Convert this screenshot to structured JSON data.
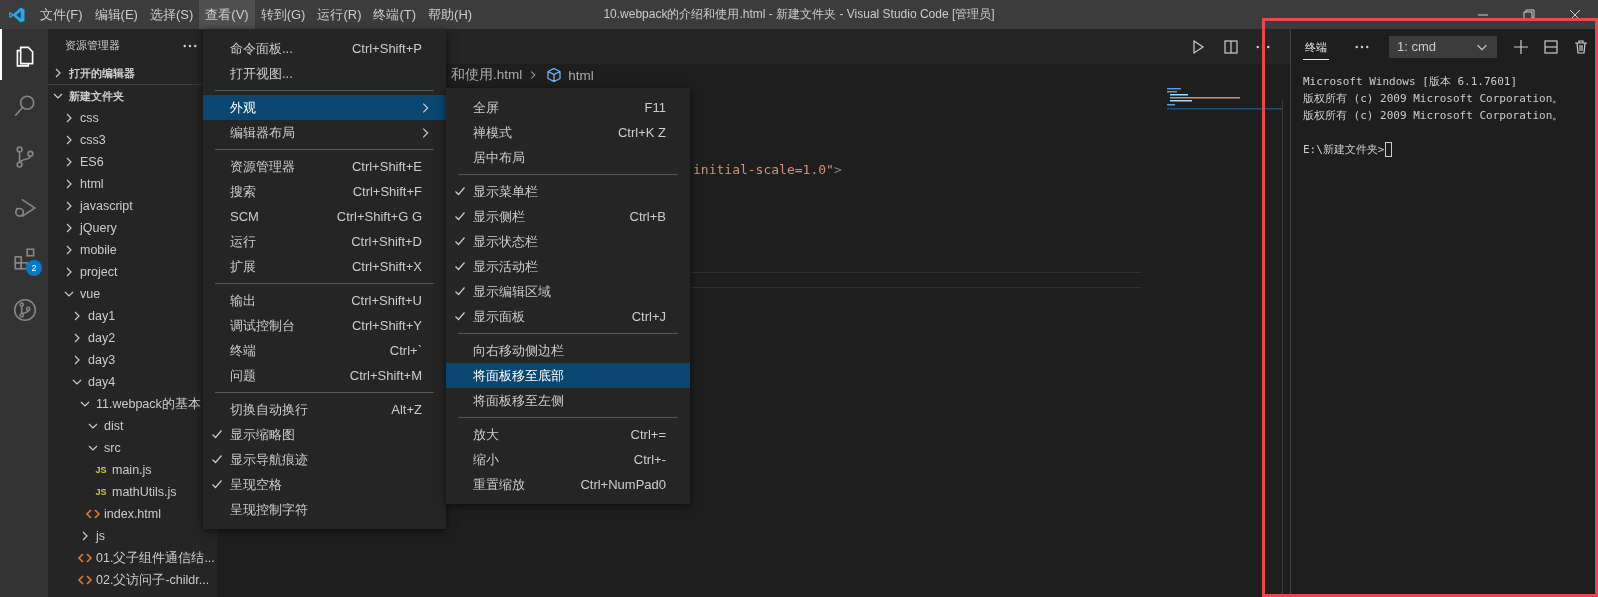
{
  "title_bar": {
    "menus": [
      {
        "label": "文件(F)",
        "selected": false
      },
      {
        "label": "编辑(E)",
        "selected": false
      },
      {
        "label": "选择(S)",
        "selected": false
      },
      {
        "label": "查看(V)",
        "selected": true
      },
      {
        "label": "转到(G)",
        "selected": false
      },
      {
        "label": "运行(R)",
        "selected": false
      },
      {
        "label": "终端(T)",
        "selected": false
      },
      {
        "label": "帮助(H)",
        "selected": false
      }
    ],
    "title": "10.webpack的介绍和使用.html - 新建文件夹 - Visual Studio Code [管理员]"
  },
  "activity_bar": {
    "items": [
      {
        "selected": true
      },
      {
        "selected": false
      },
      {
        "selected": false
      },
      {
        "selected": false
      },
      {
        "selected": false,
        "badge": "2"
      },
      {
        "selected": false
      }
    ]
  },
  "sidebar": {
    "title": "资源管理器",
    "sections": [
      {
        "label": "打开的编辑器",
        "expanded": false
      },
      {
        "label": "新建文件夹",
        "expanded": true,
        "children": [
          {
            "label": "css",
            "kind": "folder",
            "expanded": false
          },
          {
            "label": "css3",
            "kind": "folder",
            "expanded": false
          },
          {
            "label": "ES6",
            "kind": "folder",
            "expanded": false
          },
          {
            "label": "html",
            "kind": "folder",
            "expanded": false
          },
          {
            "label": "javascript",
            "kind": "folder",
            "expanded": false
          },
          {
            "label": "jQuery",
            "kind": "folder",
            "expanded": false
          },
          {
            "label": "mobile",
            "kind": "folder",
            "expanded": false
          },
          {
            "label": "project",
            "kind": "folder",
            "expanded": false
          },
          {
            "label": "vue",
            "kind": "folder",
            "expanded": true,
            "children": [
              {
                "label": "day1",
                "kind": "folder",
                "expanded": false
              },
              {
                "label": "day2",
                "kind": "folder",
                "expanded": false
              },
              {
                "label": "day3",
                "kind": "folder",
                "expanded": false
              },
              {
                "label": "day4",
                "kind": "folder",
                "expanded": true,
                "children": [
                  {
                    "label": "11.webpack的基本",
                    "kind": "folder",
                    "expanded": true,
                    "children": [
                      {
                        "label": "dist",
                        "kind": "folder",
                        "expanded": true
                      },
                      {
                        "label": "src",
                        "kind": "folder",
                        "expanded": true,
                        "children": [
                          {
                            "label": "main.js",
                            "kind": "js",
                            "icon_label": "JS"
                          },
                          {
                            "label": "mathUtils.js",
                            "kind": "js",
                            "icon_label": "JS"
                          }
                        ]
                      },
                      {
                        "label": "index.html",
                        "kind": "html"
                      }
                    ]
                  },
                  {
                    "label": "js",
                    "kind": "folder",
                    "expanded": false
                  },
                  {
                    "label": "01.父子组件通信结...",
                    "kind": "html"
                  },
                  {
                    "label": "02.父访问子-childr...",
                    "kind": "html"
                  }
                ]
              }
            ]
          }
        ]
      }
    ]
  },
  "menu": {
    "items": [
      {
        "kind": "item",
        "label": "命令面板...",
        "shortcut": "Ctrl+Shift+P",
        "checked": false,
        "selected": false
      },
      {
        "kind": "item",
        "label": "打开视图...",
        "checked": false,
        "selected": false
      },
      {
        "kind": "separator"
      },
      {
        "kind": "submenu",
        "label": "外观",
        "checked": false,
        "selected": true
      },
      {
        "kind": "submenu",
        "label": "编辑器布局",
        "checked": false,
        "selected": false
      },
      {
        "kind": "separator"
      },
      {
        "kind": "item",
        "label": "资源管理器",
        "shortcut": "Ctrl+Shift+E",
        "checked": false,
        "selected": false
      },
      {
        "kind": "item",
        "label": "搜索",
        "shortcut": "Ctrl+Shift+F",
        "checked": false,
        "selected": false
      },
      {
        "kind": "item",
        "label": "SCM",
        "shortcut": "Ctrl+Shift+G G",
        "checked": false,
        "selected": false
      },
      {
        "kind": "item",
        "label": "运行",
        "shortcut": "Ctrl+Shift+D",
        "checked": false,
        "selected": false
      },
      {
        "kind": "item",
        "label": "扩展",
        "shortcut": "Ctrl+Shift+X",
        "checked": false,
        "selected": false
      },
      {
        "kind": "separator"
      },
      {
        "kind": "item",
        "label": "输出",
        "shortcut": "Ctrl+Shift+U",
        "checked": false,
        "selected": false
      },
      {
        "kind": "item",
        "label": "调试控制台",
        "shortcut": "Ctrl+Shift+Y",
        "checked": false,
        "selected": false
      },
      {
        "kind": "item",
        "label": "终端",
        "shortcut": "Ctrl+`",
        "checked": false,
        "selected": false
      },
      {
        "kind": "item",
        "label": "问题",
        "shortcut": "Ctrl+Shift+M",
        "checked": false,
        "selected": false
      },
      {
        "kind": "separator"
      },
      {
        "kind": "item",
        "label": "切换自动换行",
        "shortcut": "Alt+Z",
        "checked": false,
        "selected": false
      },
      {
        "kind": "item",
        "label": "显示缩略图",
        "checked": true,
        "selected": false
      },
      {
        "kind": "item",
        "label": "显示导航痕迹",
        "checked": true,
        "selected": false
      },
      {
        "kind": "item",
        "label": "呈现空格",
        "checked": true,
        "selected": false
      },
      {
        "kind": "item",
        "label": "呈现控制字符",
        "checked": false,
        "selected": false
      }
    ]
  },
  "submenu": {
    "items": [
      {
        "kind": "item",
        "label": "全屏",
        "shortcut": "F11",
        "checked": false,
        "selected": false
      },
      {
        "kind": "item",
        "label": "禅模式",
        "shortcut": "Ctrl+K Z",
        "checked": false,
        "selected": false
      },
      {
        "kind": "item",
        "label": "居中布局",
        "checked": false,
        "selected": false
      },
      {
        "kind": "separator"
      },
      {
        "kind": "item",
        "label": "显示菜单栏",
        "checked": true,
        "selected": false
      },
      {
        "kind": "item",
        "label": "显示侧栏",
        "shortcut": "Ctrl+B",
        "checked": true,
        "selected": false
      },
      {
        "kind": "item",
        "label": "显示状态栏",
        "checked": true,
        "selected": false
      },
      {
        "kind": "item",
        "label": "显示活动栏",
        "checked": true,
        "selected": false
      },
      {
        "kind": "item",
        "label": "显示编辑区域",
        "checked": true,
        "selected": false
      },
      {
        "kind": "item",
        "label": "显示面板",
        "shortcut": "Ctrl+J",
        "checked": true,
        "selected": false
      },
      {
        "kind": "separator"
      },
      {
        "kind": "item",
        "label": "向右移动侧边栏",
        "checked": false,
        "selected": false
      },
      {
        "kind": "item",
        "label": "将面板移至底部",
        "checked": false,
        "selected": true
      },
      {
        "kind": "item",
        "label": "将面板移至左侧",
        "checked": false,
        "selected": false
      },
      {
        "kind": "separator"
      },
      {
        "kind": "item",
        "label": "放大",
        "shortcut": "Ctrl+=",
        "checked": false,
        "selected": false
      },
      {
        "kind": "item",
        "label": "缩小",
        "shortcut": "Ctrl+-",
        "checked": false,
        "selected": false
      },
      {
        "kind": "item",
        "label": "重置缩放",
        "shortcut": "Ctrl+NumPad0",
        "checked": false,
        "selected": false
      }
    ]
  },
  "editor": {
    "breadcrumb": [
      "和使用.html",
      "html"
    ],
    "code": [
      {
        "text": "initial-scale=1.0\"",
        "kind": "string"
      },
      {
        "text": ">",
        "kind": "punct"
      }
    ]
  },
  "panel": {
    "tabs": [
      {
        "label": "终端",
        "selected": true
      }
    ],
    "terminal_select": "1: cmd",
    "lines": [
      "Microsoft Windows [版本 6.1.7601]",
      "版权所有 (c) 2009 Microsoft Corporation。",
      "版权所有 (c) 2009 Microsoft Corporation。"
    ],
    "prompt": "E:\\新建文件夹>"
  }
}
